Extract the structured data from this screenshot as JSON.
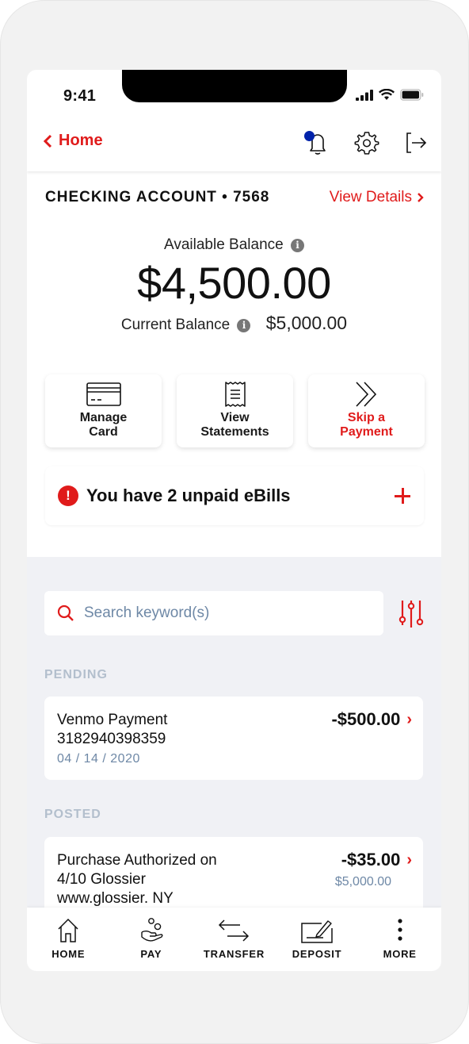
{
  "status_bar": {
    "time": "9:41"
  },
  "nav": {
    "back_label": "Home",
    "icons": [
      "bell-icon",
      "gear-icon",
      "logout-icon"
    ]
  },
  "account": {
    "name": "CHECKING ACCOUNT • 7568",
    "view_details": "View Details",
    "available_label": "Available Balance",
    "available_amount": "$4,500.00",
    "current_label": "Current Balance",
    "current_amount": "$5,000.00",
    "info_glyph": "i"
  },
  "tiles": [
    {
      "label_line1": "Manage",
      "label_line2": "Card",
      "icon": "credit-card-icon"
    },
    {
      "label_line1": "View",
      "label_line2": "Statements",
      "icon": "receipt-icon"
    },
    {
      "label_line1": "Skip a",
      "label_line2": "Payment",
      "icon": "double-chevron-icon"
    }
  ],
  "ebill": {
    "alert_glyph": "!",
    "text": "You have 2 unpaid eBills"
  },
  "search": {
    "placeholder": "Search keyword(s)",
    "value": ""
  },
  "sections": {
    "pending": "PENDING",
    "posted": "POSTED"
  },
  "pending": [
    {
      "line1": "Venmo Payment",
      "line2": "3182940398359",
      "date": "04 / 14 / 2020",
      "amount": "-$500.00"
    }
  ],
  "posted": [
    {
      "line1": "Purchase Authorized on",
      "line2": "4/10 Glossier",
      "line3": "www.glossier. NY",
      "amount": "-$35.00",
      "balance": "$5,000.00"
    }
  ],
  "tabbar": [
    {
      "label": "HOME",
      "icon": "home-icon"
    },
    {
      "label": "PAY",
      "icon": "pay-hand-icon"
    },
    {
      "label": "TRANSFER",
      "icon": "transfer-arrows-icon"
    },
    {
      "label": "DEPOSIT",
      "icon": "check-deposit-icon"
    },
    {
      "label": "MORE",
      "icon": "more-dots-icon"
    }
  ],
  "colors": {
    "accent_red": "#e01b1b",
    "notification_dot": "#0022aa",
    "muted_blue": "#6e88a6",
    "gray_bg": "#f0f1f5"
  }
}
